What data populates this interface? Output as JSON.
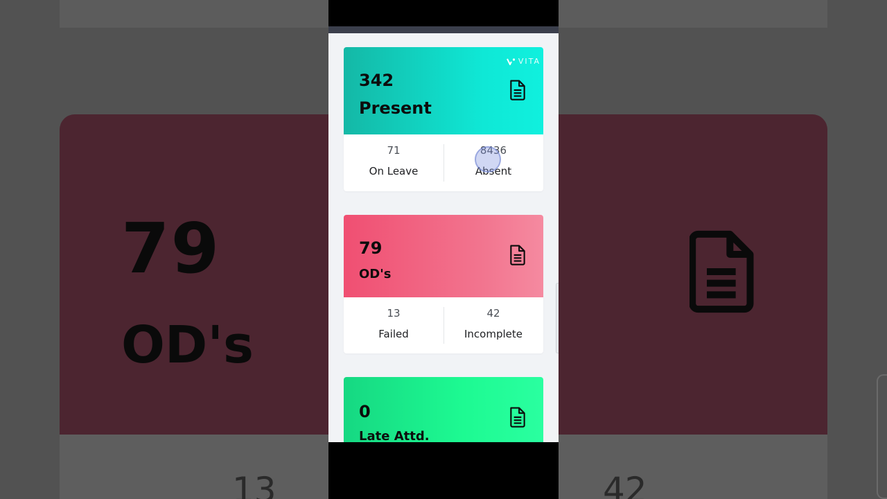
{
  "brand": {
    "name": "VITA"
  },
  "cards": [
    {
      "count": "342",
      "label": "Present",
      "icon": "document-icon",
      "color": "#14b8a6",
      "stats": [
        {
          "value": "71",
          "label": "On Leave"
        },
        {
          "value": "8436",
          "label": "Absent"
        }
      ]
    },
    {
      "count": "79",
      "label": "OD's",
      "icon": "document-icon",
      "color": "#f04f72",
      "stats": [
        {
          "value": "13",
          "label": "Failed"
        },
        {
          "value": "42",
          "label": "Incomplete"
        }
      ]
    },
    {
      "count": "0",
      "label": "Late Attd.",
      "icon": "document-icon",
      "color": "#1dfa92"
    }
  ]
}
